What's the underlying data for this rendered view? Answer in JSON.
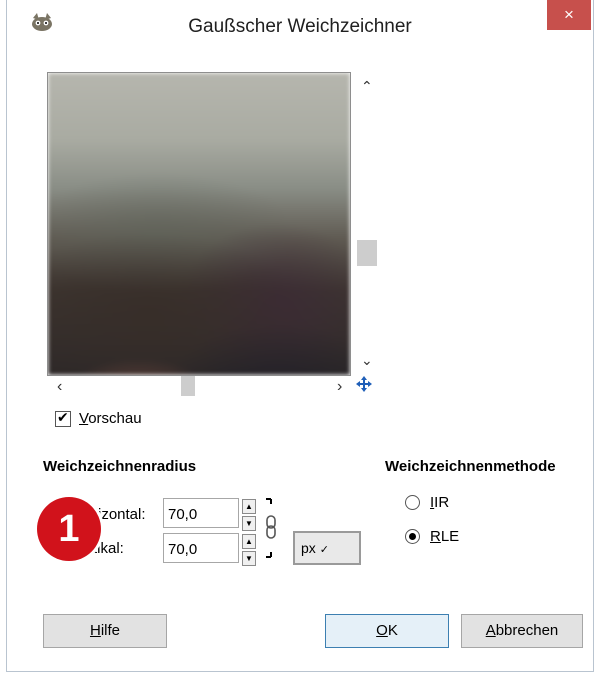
{
  "window": {
    "title": "Gaußscher Weichzeichner",
    "close_label": "×"
  },
  "preview": {
    "checkbox_label_ul": "V",
    "checkbox_label_rest": "orschau",
    "checked": true
  },
  "radius": {
    "section_title": "Weichzeichnenradius",
    "horizontal_label": "rizontal:",
    "horizontal_value": "70,0",
    "vertical_label": "tikal:",
    "vertical_value": "70,0",
    "unit": "px"
  },
  "method": {
    "section_title": "Weichzeichnenmethode",
    "options": [
      {
        "ul": "I",
        "rest": "IR",
        "selected": false
      },
      {
        "ul": "R",
        "rest": "LE",
        "selected": true
      }
    ]
  },
  "badge": {
    "number": "1"
  },
  "buttons": {
    "help_ul": "H",
    "help_rest": "ilfe",
    "ok_ul": "O",
    "ok_rest": "K",
    "cancel_ul": "A",
    "cancel_rest": "bbrechen"
  },
  "colors": {
    "close_bg": "#c7504c",
    "badge_bg": "#d1121b",
    "primary_border": "#3c7fb1"
  }
}
